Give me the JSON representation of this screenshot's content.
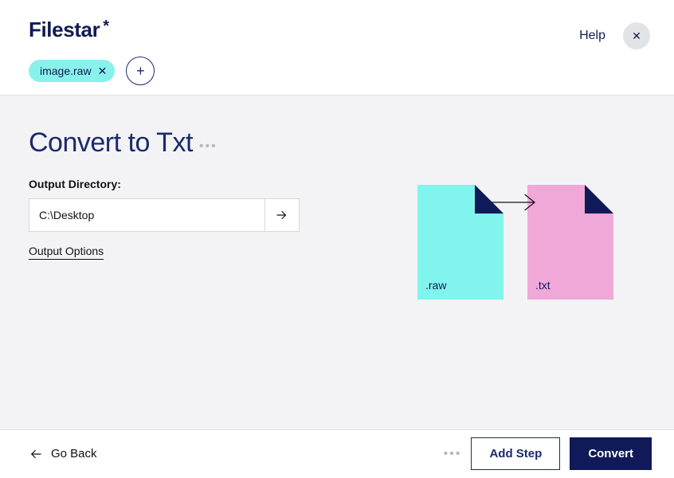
{
  "brand": {
    "name": "Filestar",
    "mark": "*"
  },
  "header": {
    "help": "Help",
    "files": [
      {
        "name": "image.raw"
      }
    ]
  },
  "page": {
    "title": "Convert to Txt",
    "output_directory_label": "Output Directory:",
    "output_directory_value": "C:\\Desktop",
    "output_options_label": "Output Options"
  },
  "diagram": {
    "from_ext": ".raw",
    "to_ext": ".txt"
  },
  "footer": {
    "go_back": "Go Back",
    "add_step": "Add Step",
    "convert": "Convert"
  }
}
